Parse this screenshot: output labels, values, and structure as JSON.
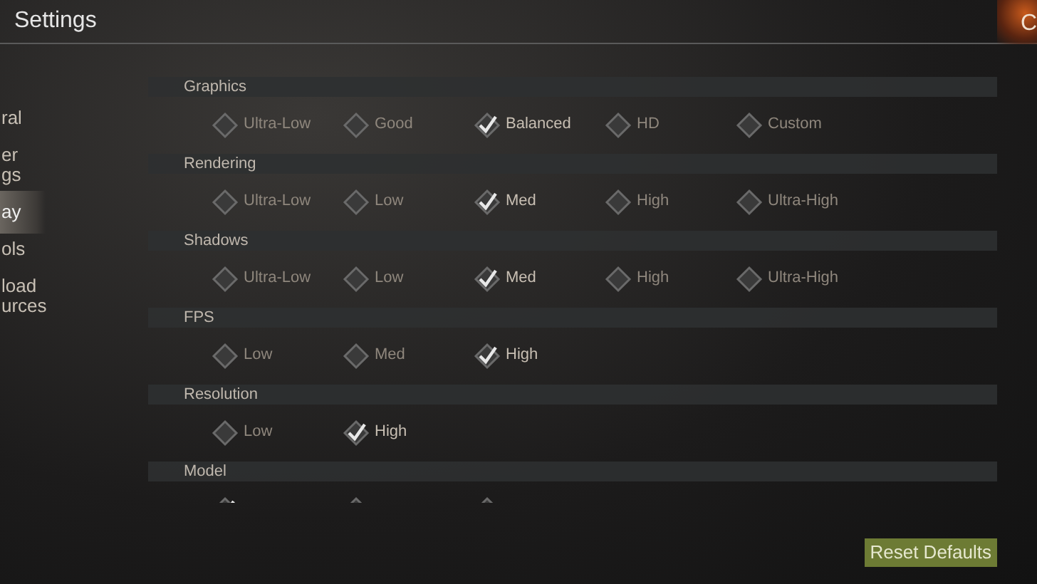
{
  "title": "Settings",
  "corner_button": {
    "label": "C"
  },
  "sidebar": {
    "items": [
      {
        "lines": [
          "ral"
        ],
        "selected": false
      },
      {
        "lines": [
          "er",
          "gs"
        ],
        "selected": false
      },
      {
        "lines": [
          "ay"
        ],
        "selected": true
      },
      {
        "lines": [
          "ols"
        ],
        "selected": false
      },
      {
        "lines": [
          "load",
          "urces"
        ],
        "selected": false
      }
    ]
  },
  "sections": [
    {
      "label": "Graphics",
      "options": [
        {
          "label": "Ultra-Low",
          "selected": false
        },
        {
          "label": "Good",
          "selected": false
        },
        {
          "label": "Balanced",
          "selected": true
        },
        {
          "label": "HD",
          "selected": false
        },
        {
          "label": "Custom",
          "selected": false
        }
      ]
    },
    {
      "label": "Rendering",
      "options": [
        {
          "label": "Ultra-Low",
          "selected": false
        },
        {
          "label": "Low",
          "selected": false
        },
        {
          "label": "Med",
          "selected": true
        },
        {
          "label": "High",
          "selected": false
        },
        {
          "label": "Ultra-High",
          "selected": false
        }
      ]
    },
    {
      "label": "Shadows",
      "options": [
        {
          "label": "Ultra-Low",
          "selected": false
        },
        {
          "label": "Low",
          "selected": false
        },
        {
          "label": "Med",
          "selected": true
        },
        {
          "label": "High",
          "selected": false
        },
        {
          "label": "Ultra-High",
          "selected": false
        }
      ]
    },
    {
      "label": "FPS",
      "options": [
        {
          "label": "Low",
          "selected": false
        },
        {
          "label": "Med",
          "selected": false
        },
        {
          "label": "High",
          "selected": true
        }
      ]
    },
    {
      "label": "Resolution",
      "options": [
        {
          "label": "Low",
          "selected": false
        },
        {
          "label": "High",
          "selected": true
        }
      ]
    },
    {
      "label": "Model",
      "options": [
        {
          "selected": true
        },
        {
          "selected": false
        },
        {
          "selected": false
        }
      ]
    }
  ],
  "reset_button": {
    "label": "Reset Defaults"
  }
}
